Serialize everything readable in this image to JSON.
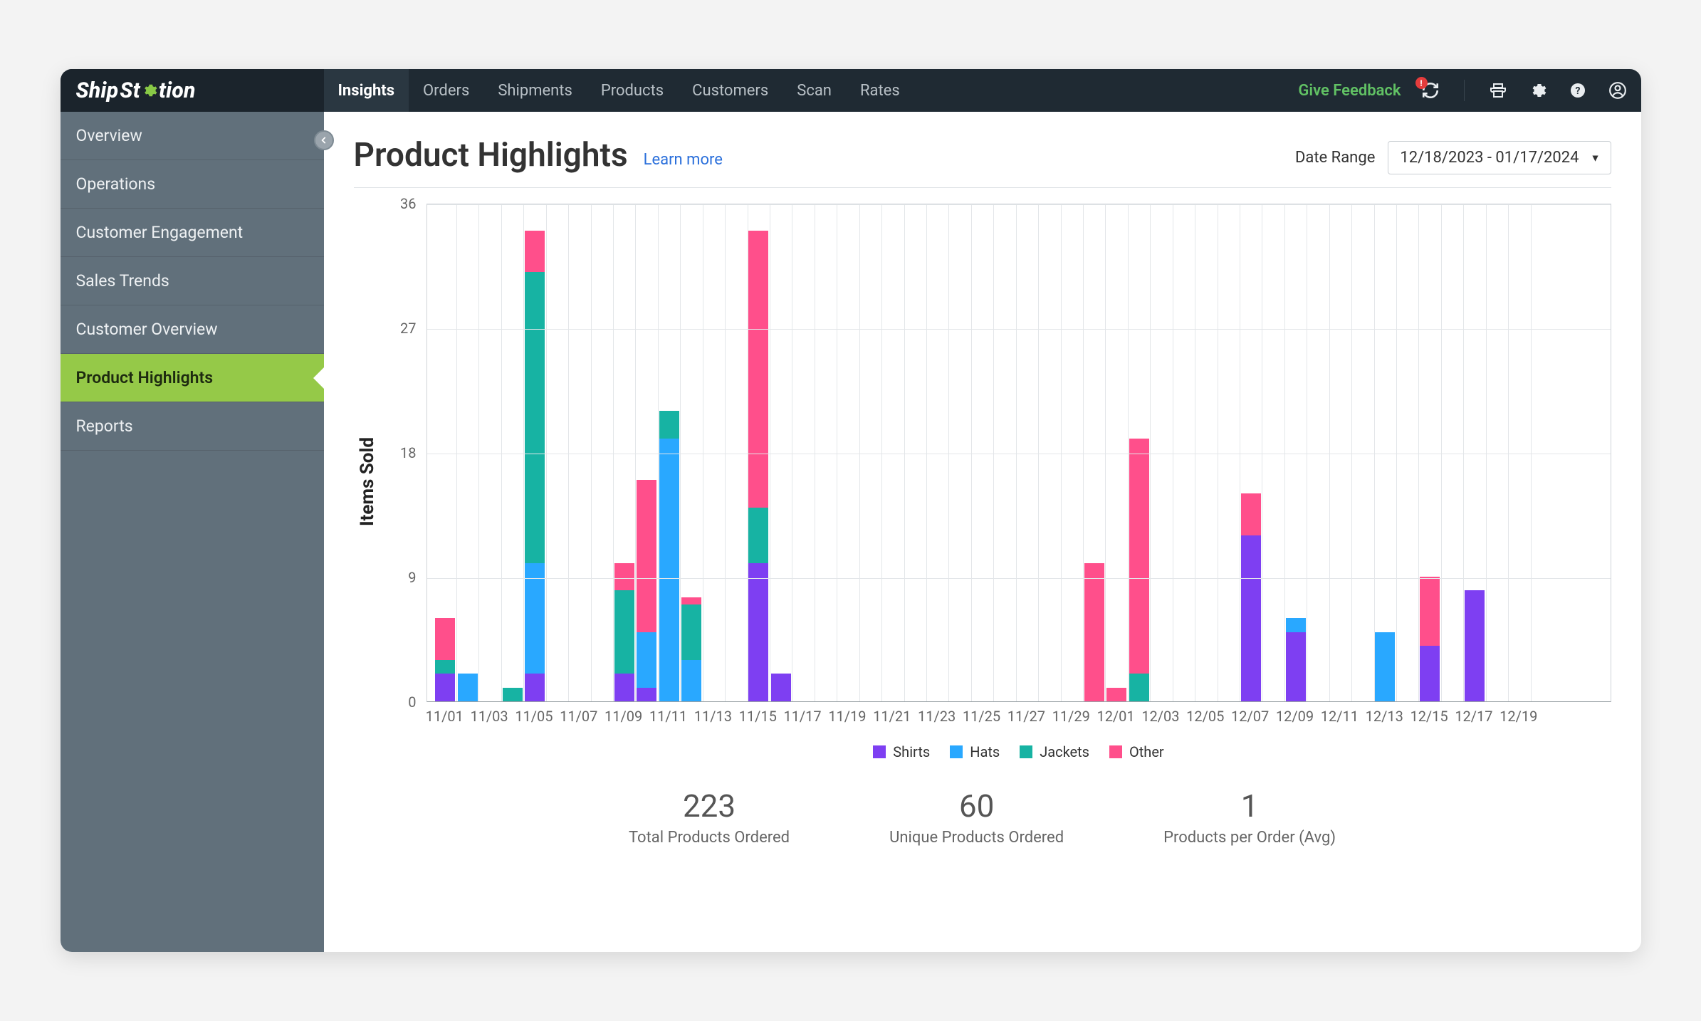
{
  "brand": {
    "name": "ShipStation"
  },
  "nav": {
    "items": [
      "Insights",
      "Orders",
      "Shipments",
      "Products",
      "Customers",
      "Scan",
      "Rates"
    ],
    "active": "Insights",
    "feedback": "Give Feedback"
  },
  "sidebar": {
    "items": [
      "Overview",
      "Operations",
      "Customer Engagement",
      "Sales Trends",
      "Customer Overview",
      "Product Highlights",
      "Reports"
    ],
    "active": "Product Highlights"
  },
  "header": {
    "title": "Product Highlights",
    "learn_more": "Learn more",
    "date_range_label": "Date Range",
    "date_range_value": "12/18/2023 - 01/17/2024"
  },
  "colors": {
    "shirts": "#7e3ff2",
    "hats": "#29a8ff",
    "jackets": "#17b3a3",
    "other": "#ff4f8b",
    "accent": "#95c948"
  },
  "chart_data": {
    "type": "bar",
    "stacked": true,
    "ylabel": "Items Sold",
    "xlabel": "",
    "ylim": [
      0,
      36
    ],
    "y_ticks": [
      0,
      9,
      18,
      27,
      36
    ],
    "x_ticks": [
      "11/01",
      "11/03",
      "11/05",
      "11/07",
      "11/09",
      "11/11",
      "11/13",
      "11/15",
      "11/17",
      "11/19",
      "11/21",
      "11/23",
      "11/25",
      "11/27",
      "11/29",
      "12/01",
      "12/03",
      "12/05",
      "12/07",
      "12/09",
      "12/11",
      "12/13",
      "12/15",
      "12/17",
      "12/19"
    ],
    "categories": [
      "11/01",
      "11/02",
      "11/03",
      "11/04",
      "11/05",
      "11/06",
      "11/07",
      "11/08",
      "11/09",
      "11/10",
      "11/11",
      "11/12",
      "11/13",
      "11/14",
      "11/15",
      "11/16",
      "11/17",
      "11/18",
      "11/19",
      "11/20",
      "11/21",
      "11/22",
      "11/23",
      "11/24",
      "11/25",
      "11/26",
      "11/27",
      "11/28",
      "11/29",
      "11/30",
      "12/01",
      "12/02",
      "12/03",
      "12/04",
      "12/05",
      "12/06",
      "12/07",
      "12/08",
      "12/09",
      "12/10",
      "12/11",
      "12/12",
      "12/13",
      "12/14",
      "12/15",
      "12/16",
      "12/17",
      "12/18",
      "12/19"
    ],
    "series": [
      {
        "name": "Shirts",
        "key": "shirts",
        "values": [
          2,
          0,
          0,
          0,
          2,
          0,
          0,
          0,
          2,
          1,
          0,
          0,
          0,
          0,
          10,
          2,
          0,
          0,
          0,
          0,
          0,
          0,
          0,
          0,
          0,
          0,
          0,
          0,
          0,
          0,
          0,
          0,
          0,
          0,
          0,
          0,
          12,
          0,
          5,
          0,
          0,
          0,
          0,
          0,
          4,
          0,
          8,
          0,
          0
        ]
      },
      {
        "name": "Hats",
        "key": "hats",
        "values": [
          0,
          2,
          0,
          0,
          8,
          0,
          0,
          0,
          0,
          4,
          19,
          3,
          0,
          0,
          0,
          0,
          0,
          0,
          0,
          0,
          0,
          0,
          0,
          0,
          0,
          0,
          0,
          0,
          0,
          0,
          0,
          0,
          0,
          0,
          0,
          0,
          0,
          0,
          1,
          0,
          0,
          0,
          5,
          0,
          0,
          0,
          0,
          0,
          0
        ]
      },
      {
        "name": "Jackets",
        "key": "jackets",
        "values": [
          1,
          0,
          0,
          1,
          21,
          0,
          0,
          0,
          6,
          0,
          2,
          4,
          0,
          0,
          4,
          0,
          0,
          0,
          0,
          0,
          0,
          0,
          0,
          0,
          0,
          0,
          0,
          0,
          0,
          0,
          0,
          2,
          0,
          0,
          0,
          0,
          0,
          0,
          0,
          0,
          0,
          0,
          0,
          0,
          0,
          0,
          0,
          0,
          0
        ]
      },
      {
        "name": "Other",
        "key": "other",
        "values": [
          3,
          0,
          0,
          0,
          3,
          0,
          0,
          0,
          2,
          11,
          0,
          0.5,
          0,
          0,
          20,
          0,
          0,
          0,
          0,
          0,
          0,
          0,
          0,
          0,
          0,
          0,
          0,
          0,
          0,
          10,
          1,
          17,
          0,
          0,
          0,
          0,
          3,
          0,
          0,
          0,
          0,
          0,
          0,
          0,
          5,
          0,
          0,
          0,
          0
        ]
      }
    ],
    "legend": [
      "Shirts",
      "Hats",
      "Jackets",
      "Other"
    ]
  },
  "stats": [
    {
      "value": "223",
      "label": "Total Products Ordered"
    },
    {
      "value": "60",
      "label": "Unique Products Ordered"
    },
    {
      "value": "1",
      "label": "Products per Order (Avg)"
    }
  ]
}
